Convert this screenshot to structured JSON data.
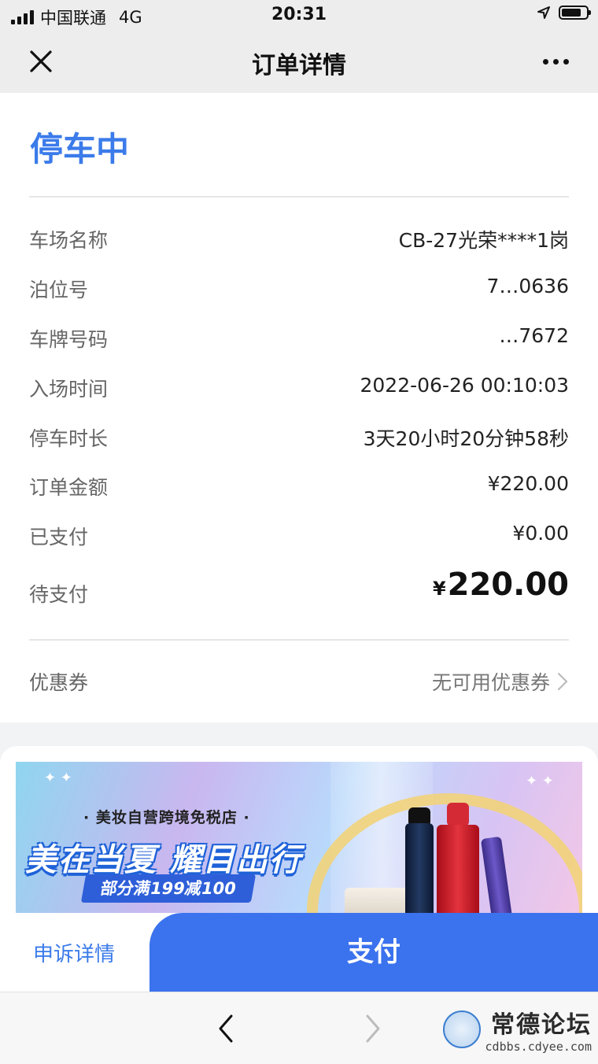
{
  "status_bar": {
    "carrier": "中国联通",
    "network": "4G",
    "time": "20:31"
  },
  "nav": {
    "title": "订单详情",
    "close_icon": "close-icon",
    "more_icon": "more-icon"
  },
  "order": {
    "status": "停车中",
    "rows": [
      {
        "label": "车场名称",
        "value": "CB-27光荣****1岗"
      },
      {
        "label": "泊位号",
        "value": "7…0636"
      },
      {
        "label": "车牌号码",
        "value": "…7672"
      },
      {
        "label": "入场时间",
        "value": "2022-06-26 00:10:03"
      },
      {
        "label": "停车时长",
        "value": "3天20小时20分钟58秒"
      },
      {
        "label": "订单金额",
        "value": "¥220.00"
      },
      {
        "label": "已支付",
        "value": "¥0.00"
      }
    ],
    "pending": {
      "label": "待支付",
      "currency": "¥",
      "amount": "220.00"
    },
    "coupon": {
      "label": "优惠券",
      "value": "无可用优惠券"
    }
  },
  "ad": {
    "tagline": "· 美妆自营跨境免税店 ·",
    "headline": "美在当夏 耀目出行",
    "promo": "部分满199减100"
  },
  "actions": {
    "appeal": "申诉详情",
    "pay": "支付"
  },
  "watermark": {
    "name": "常德论坛",
    "url": "cdbbs.cdyee.com"
  },
  "colors": {
    "accent": "#3b7bea",
    "pay_button": "#3b72ee"
  }
}
